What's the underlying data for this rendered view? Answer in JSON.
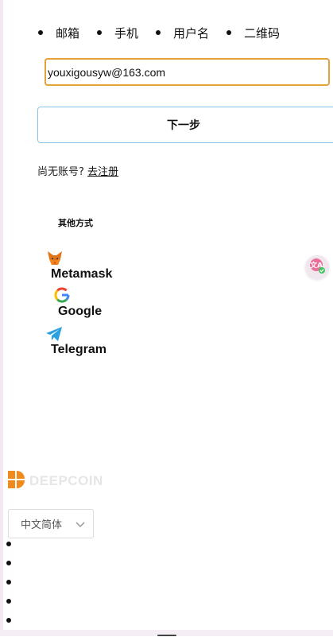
{
  "login_tabs": [
    {
      "label": "邮箱"
    },
    {
      "label": "手机"
    },
    {
      "label": "用户名"
    },
    {
      "label": "二维码"
    }
  ],
  "email_input": {
    "value": "youxigousyw@163.com",
    "accent_color": "#e3a33a"
  },
  "next_button": {
    "label": "下一步"
  },
  "register": {
    "prompt": "尚无账号?",
    "link": "去注册"
  },
  "other_methods": {
    "title": "其他方式",
    "items": [
      {
        "label": "Metamask",
        "icon": "metamask-fox-icon"
      },
      {
        "label": "Google",
        "icon": "google-g-icon"
      },
      {
        "label": "Telegram",
        "icon": "telegram-plane-icon"
      }
    ]
  },
  "footer": {
    "brand_name": "DEEPCOIN",
    "brand_color": "#f08a1c",
    "language_select": {
      "selected": "中文简体"
    },
    "bullet_count": 5
  }
}
